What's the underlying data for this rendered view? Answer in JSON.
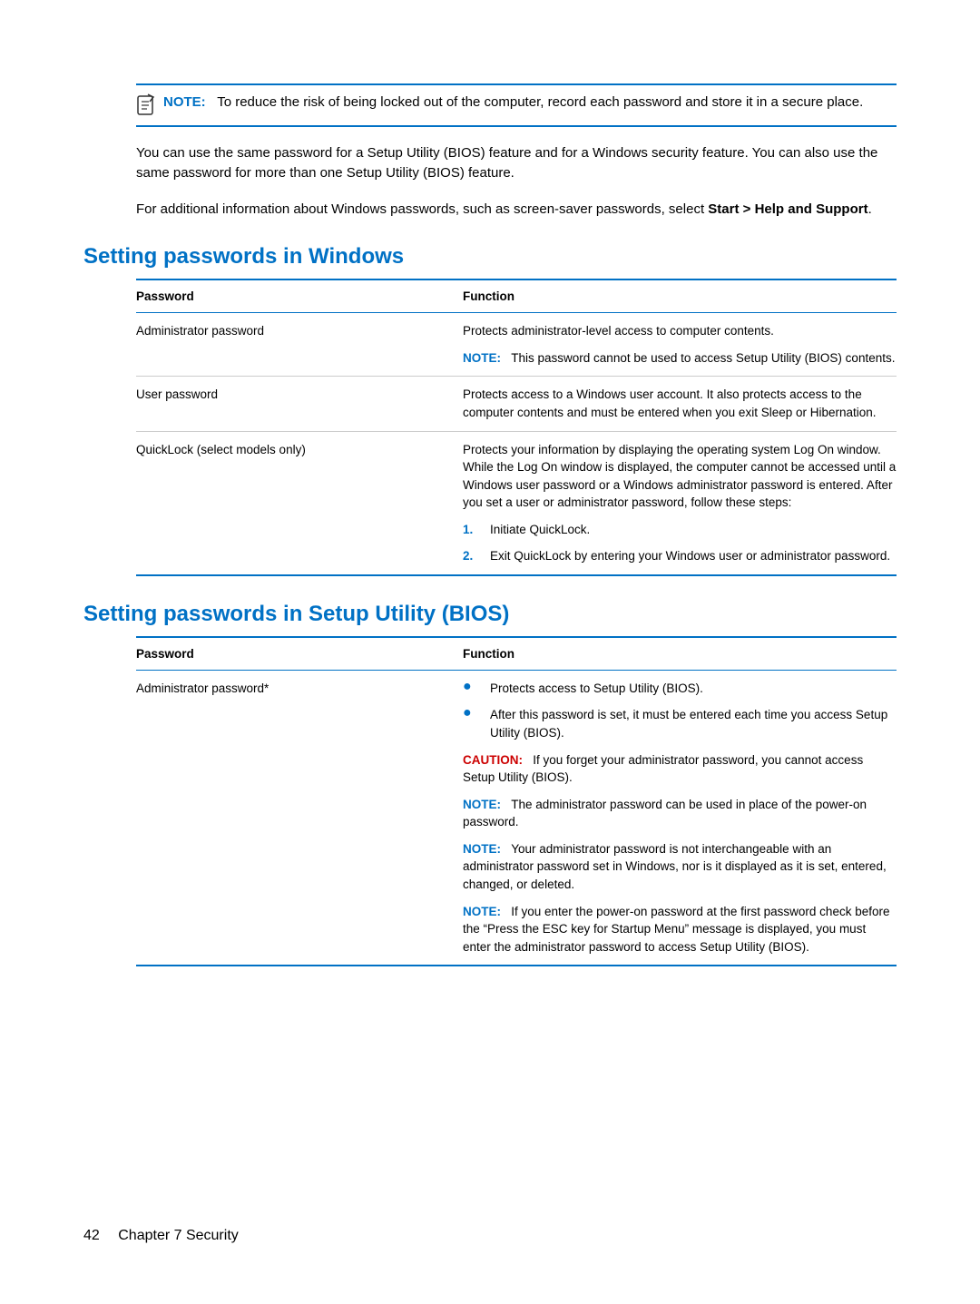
{
  "top_note": {
    "label": "NOTE:",
    "text": "To reduce the risk of being locked out of the computer, record each password and store it in a secure place."
  },
  "para1": "You can use the same password for a Setup Utility (BIOS) feature and for a Windows security feature. You can also use the same password for more than one Setup Utility (BIOS) feature.",
  "para2_pre": "For additional information about Windows passwords, such as screen-saver passwords, select ",
  "para2_strong": "Start > Help and Support",
  "para2_post": ".",
  "heading_win": "Setting passwords in Windows",
  "table_win": {
    "headers": {
      "col1": "Password",
      "col2": "Function"
    },
    "rows": [
      {
        "name": "Administrator password",
        "desc1": "Protects administrator-level access to computer contents.",
        "note_label": "NOTE:",
        "note_text": "This password cannot be used to access Setup Utility (BIOS) contents."
      },
      {
        "name": "User password",
        "desc1": "Protects access to a Windows user account. It also protects access to the computer contents and must be entered when you exit Sleep or Hibernation."
      },
      {
        "name": "QuickLock (select models only)",
        "desc1": "Protects your information by displaying the operating system Log On window. While the Log On window is displayed, the computer cannot be accessed until a Windows user password or a Windows administrator password is entered. After you set a user or administrator password, follow these steps:",
        "steps": [
          {
            "num": "1.",
            "text": "Initiate QuickLock."
          },
          {
            "num": "2.",
            "text": "Exit QuickLock by entering your Windows user or administrator password."
          }
        ]
      }
    ]
  },
  "heading_bios": "Setting passwords in Setup Utility (BIOS)",
  "table_bios": {
    "headers": {
      "col1": "Password",
      "col2": "Function"
    },
    "rows": [
      {
        "name": "Administrator password*",
        "bullets": [
          "Protects access to Setup Utility (BIOS).",
          "After this password is set, it must be entered each time you access Setup Utility (BIOS)."
        ],
        "caution_label": "CAUTION:",
        "caution_text": "If you forget your administrator password, you cannot access Setup Utility (BIOS).",
        "notes": [
          {
            "label": "NOTE:",
            "text": "The administrator password can be used in place of the power-on password."
          },
          {
            "label": "NOTE:",
            "text": "Your administrator password is not interchangeable with an administrator password set in Windows, nor is it displayed as it is set, entered, changed, or deleted."
          },
          {
            "label": "NOTE:",
            "text": "If you enter the power-on password at the first password check before the “Press the ESC key for Startup Menu” message is displayed, you must enter the administrator password to access Setup Utility (BIOS)."
          }
        ]
      }
    ]
  },
  "footer": {
    "page_number": "42",
    "chapter": "Chapter 7   Security"
  }
}
